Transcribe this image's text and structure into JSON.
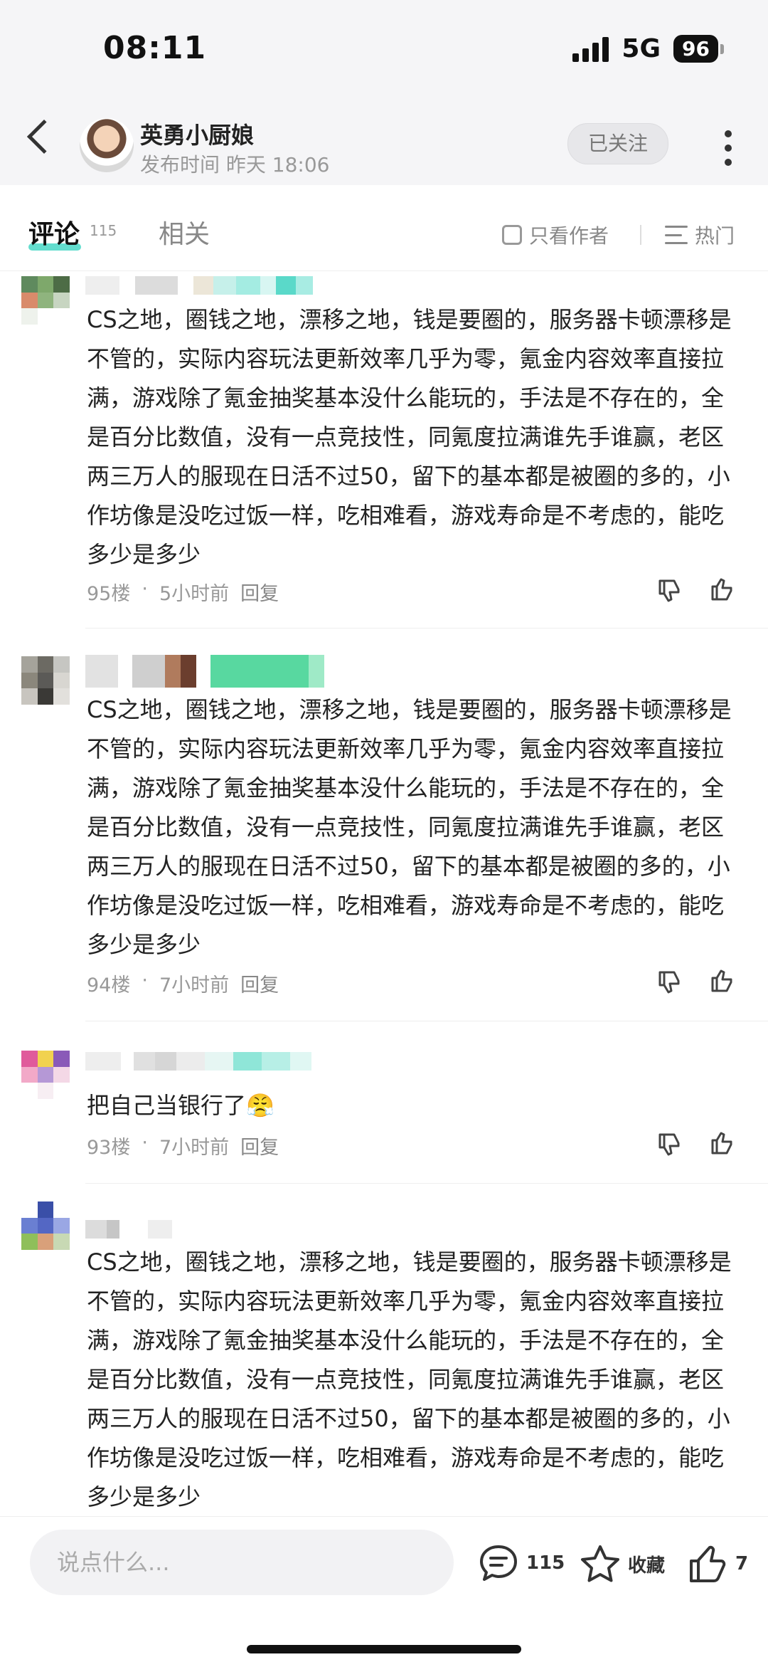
{
  "status_bar": {
    "time": "08:11",
    "network": "5G",
    "battery": "96"
  },
  "header": {
    "author_name": "英勇小厨娘",
    "publish_time": "发布时间 昨天 18:06",
    "follow_label": "已关注"
  },
  "tabs": {
    "comments_label": "评论",
    "comments_count": "115",
    "related_label": "相关",
    "author_only_label": "只看作者",
    "sort_label": "热门"
  },
  "comments": [
    {
      "text": "CS之地，圈钱之地，漂移之地，钱是要圈的，服务器卡顿漂移是不管的，实际内容玩法更新效率几乎为零，氪金内容效率直接拉满，游戏除了氪金抽奖基本没什么能玩的，手法是不存在的，全是百分比数值，没有一点竞技性，同氪度拉满谁先手谁赢，老区两三万人的服现在日活不过50，留下的基本都是被圈的多的，小作坊像是没吃过饭一样，吃相难看，游戏寿命是不考虑的，能吃多少是多少",
      "floor": "95楼",
      "time": "5小时前",
      "reply": "回复"
    },
    {
      "text": "CS之地，圈钱之地，漂移之地，钱是要圈的，服务器卡顿漂移是不管的，实际内容玩法更新效率几乎为零，氪金内容效率直接拉满，游戏除了氪金抽奖基本没什么能玩的，手法是不存在的，全是百分比数值，没有一点竞技性，同氪度拉满谁先手谁赢，老区两三万人的服现在日活不过50，留下的基本都是被圈的多的，小作坊像是没吃过饭一样，吃相难看，游戏寿命是不考虑的，能吃多少是多少",
      "floor": "94楼",
      "time": "7小时前",
      "reply": "回复"
    },
    {
      "text": "把自己当银行了😤",
      "floor": "93楼",
      "time": "7小时前",
      "reply": "回复"
    },
    {
      "text": "CS之地，圈钱之地，漂移之地，钱是要圈的，服务器卡顿漂移是不管的，实际内容玩法更新效率几乎为零，氪金内容效率直接拉满，游戏除了氪金抽奖基本没什么能玩的，手法是不存在的，全是百分比数值，没有一点竞技性，同氪度拉满谁先手谁赢，老区两三万人的服现在日活不过50，留下的基本都是被圈的多的，小作坊像是没吃过饭一样，吃相难看，游戏寿命是不考虑的，能吃多少是多少"
    }
  ],
  "bottom_bar": {
    "input_placeholder": "说点什么...",
    "comment_count": "115",
    "favorite_label": "收藏",
    "like_count": "7"
  },
  "colors": {
    "accent": "#48d7c6",
    "muted_text": "#999999"
  }
}
